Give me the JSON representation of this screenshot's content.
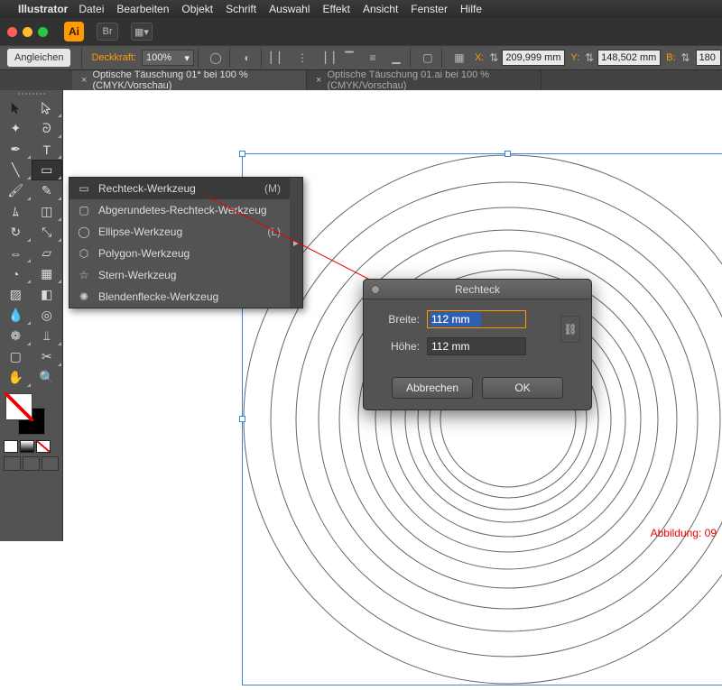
{
  "menubar": {
    "app": "Illustrator",
    "items": [
      "Datei",
      "Bearbeiten",
      "Objekt",
      "Schrift",
      "Auswahl",
      "Effekt",
      "Ansicht",
      "Fenster",
      "Hilfe"
    ]
  },
  "win_top": {
    "ai": "Ai",
    "br": "Br"
  },
  "options": {
    "align": "Angleichen",
    "opacity_label": "Deckkraft:",
    "opacity_value": "100%",
    "x_label": "X:",
    "x_value": "209,999 mm",
    "y_label": "Y:",
    "y_value": "148,502 mm",
    "b_label": "B:",
    "b_value": "180"
  },
  "tabs": [
    "Optische Täuschung 01* bei 100 % (CMYK/Vorschau)",
    "Optische Täuschung 01.ai bei 100 % (CMYK/Vorschau)"
  ],
  "flyout": {
    "items": [
      {
        "label": "Rechteck-Werkzeug",
        "shortcut": "(M)",
        "selected": true
      },
      {
        "label": "Abgerundetes-Rechteck-Werkzeug",
        "shortcut": ""
      },
      {
        "label": "Ellipse-Werkzeug",
        "shortcut": "(L)"
      },
      {
        "label": "Polygon-Werkzeug",
        "shortcut": ""
      },
      {
        "label": "Stern-Werkzeug",
        "shortcut": ""
      },
      {
        "label": "Blendenflecke-Werkzeug",
        "shortcut": ""
      }
    ]
  },
  "dialog": {
    "title": "Rechteck",
    "width_label": "Breite:",
    "width_value": "112 mm",
    "height_label": "Höhe:",
    "height_value": "112 mm",
    "cancel": "Abbrechen",
    "ok": "OK"
  },
  "caption": "Abbildung: 09"
}
